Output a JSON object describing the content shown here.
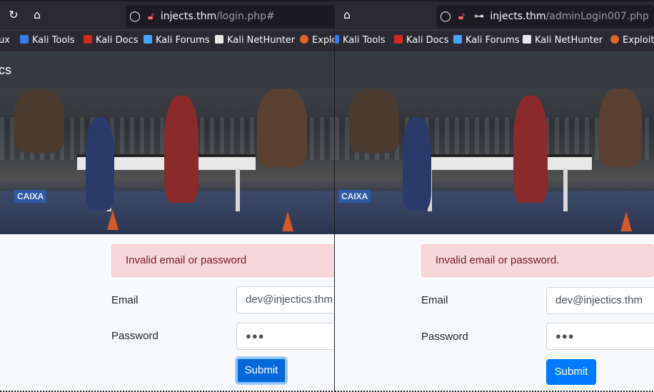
{
  "left": {
    "url_domain": "injects.thm",
    "url_path": "/login.php#",
    "bookmarks": [
      "ux",
      "Kali Tools",
      "Kali Docs",
      "Kali Forums",
      "Kali NetHunter",
      "Explo"
    ],
    "site_title": "cs",
    "alert": "Invalid email or password",
    "email_label": "Email",
    "email_value": "dev@injectics.thm",
    "password_label": "Password",
    "password_value": "●●●",
    "submit_label": "Submit"
  },
  "right": {
    "url_domain": "injects.thm",
    "url_path": "/adminLogin007.php",
    "bookmarks": [
      "Kali Tools",
      "Kali Docs",
      "Kali Forums",
      "Kali NetHunter",
      "Exploit"
    ],
    "alert": "Invalid email or password.",
    "email_label": "Email",
    "email_value": "dev@injectics.thm",
    "password_label": "Password",
    "password_value": "●●●",
    "submit_label": "Submit"
  },
  "icons": {
    "reload": "reload-icon",
    "home": "home-icon",
    "shield": "tracking-shield-icon",
    "lock": "lock-icon",
    "key": "key-icon"
  },
  "colors": {
    "alert_bg": "#f8d7da",
    "alert_text": "#721c24",
    "button": "#007bff",
    "navbar": "#343a40",
    "browser_chrome": "#2b2a33"
  }
}
